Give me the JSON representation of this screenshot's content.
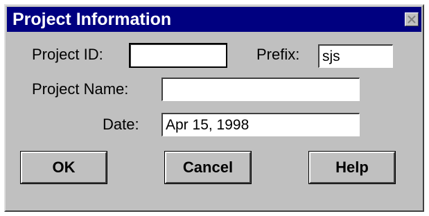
{
  "dialog": {
    "title": "Project Information",
    "close_icon": "close-icon"
  },
  "form": {
    "project_id_label": "Project ID:",
    "project_id_value": "",
    "prefix_label": "Prefix:",
    "prefix_value": "sjs",
    "project_name_label": "Project Name:",
    "project_name_value": "",
    "date_label": "Date:",
    "date_value": "Apr 15, 1998"
  },
  "buttons": {
    "ok": "OK",
    "cancel": "Cancel",
    "help": "Help"
  }
}
